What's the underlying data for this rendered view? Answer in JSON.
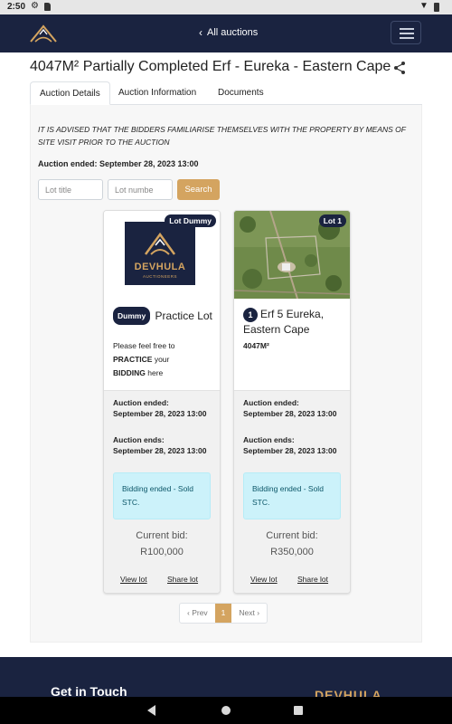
{
  "status_bar": {
    "time": "2:50"
  },
  "nav": {
    "back_label": "All auctions"
  },
  "page": {
    "title": "4047M² Partially Completed Erf - Eureka - Eastern Cape",
    "tabs": [
      "Auction Details",
      "Auction Information",
      "Documents"
    ],
    "active_tab": "Auction Details",
    "notice": "IT IS ADVISED THAT THE BIDDERS FAMILIARISE THEMSELVES WITH THE PROPERTY BY MEANS OF SITE VISIT PRIOR TO THE AUCTION",
    "auction_ended": "Auction ended: September 28, 2023 13:00"
  },
  "filters": {
    "lot_title_placeholder": "Lot title",
    "lot_number_placeholder": "Lot numbe",
    "search_label": "Search"
  },
  "lots": [
    {
      "badge": "Lot Dummy",
      "logo_text": "DEVHULA",
      "logo_sub": "AUCTIONEERS",
      "tag": "Dummy",
      "name": "Practice Lot",
      "desc_1": "Please feel free to",
      "desc_2": "PRACTICE",
      "desc_3": "your",
      "desc_4": "BIDDING",
      "desc_5": "here",
      "ended_label": "Auction ended:",
      "ended_value": "September 28, 2023 13:00",
      "ends_label": "Auction ends:",
      "ends_value": "September 28, 2023 13:00",
      "status": "Bidding ended - Sold STC.",
      "current_bid_label": "Current bid:",
      "current_bid": "R100,000",
      "view_label": "View lot",
      "share_label": "Share lot"
    },
    {
      "badge": "Lot 1",
      "number": "1",
      "name": "Erf 5 Eureka, Eastern Cape",
      "size": "4047M²",
      "ended_label": "Auction ended:",
      "ended_value": "September 28, 2023 13:00",
      "ends_label": "Auction ends:",
      "ends_value": "September 28, 2023 13:00",
      "status": "Bidding ended - Sold STC.",
      "current_bid_label": "Current bid:",
      "current_bid": "R350,000",
      "view_label": "View lot",
      "share_label": "Share lot"
    }
  ],
  "pagination": {
    "prev": "‹ Prev",
    "current": "1",
    "next": "Next ›"
  },
  "footer": {
    "heading": "Get in Touch",
    "logo_text": "DEVHULA"
  },
  "colors": {
    "navy": "#1a2340",
    "gold": "#d4a460",
    "status_bg": "#ccf2fa"
  },
  "icons": [
    "gear-icon",
    "sd-card-icon",
    "wifi-icon",
    "battery-icon",
    "brand-logo-icon",
    "chevron-left-icon",
    "hamburger-icon",
    "share-icon",
    "system-back-icon",
    "system-home-icon",
    "system-recents-icon"
  ]
}
